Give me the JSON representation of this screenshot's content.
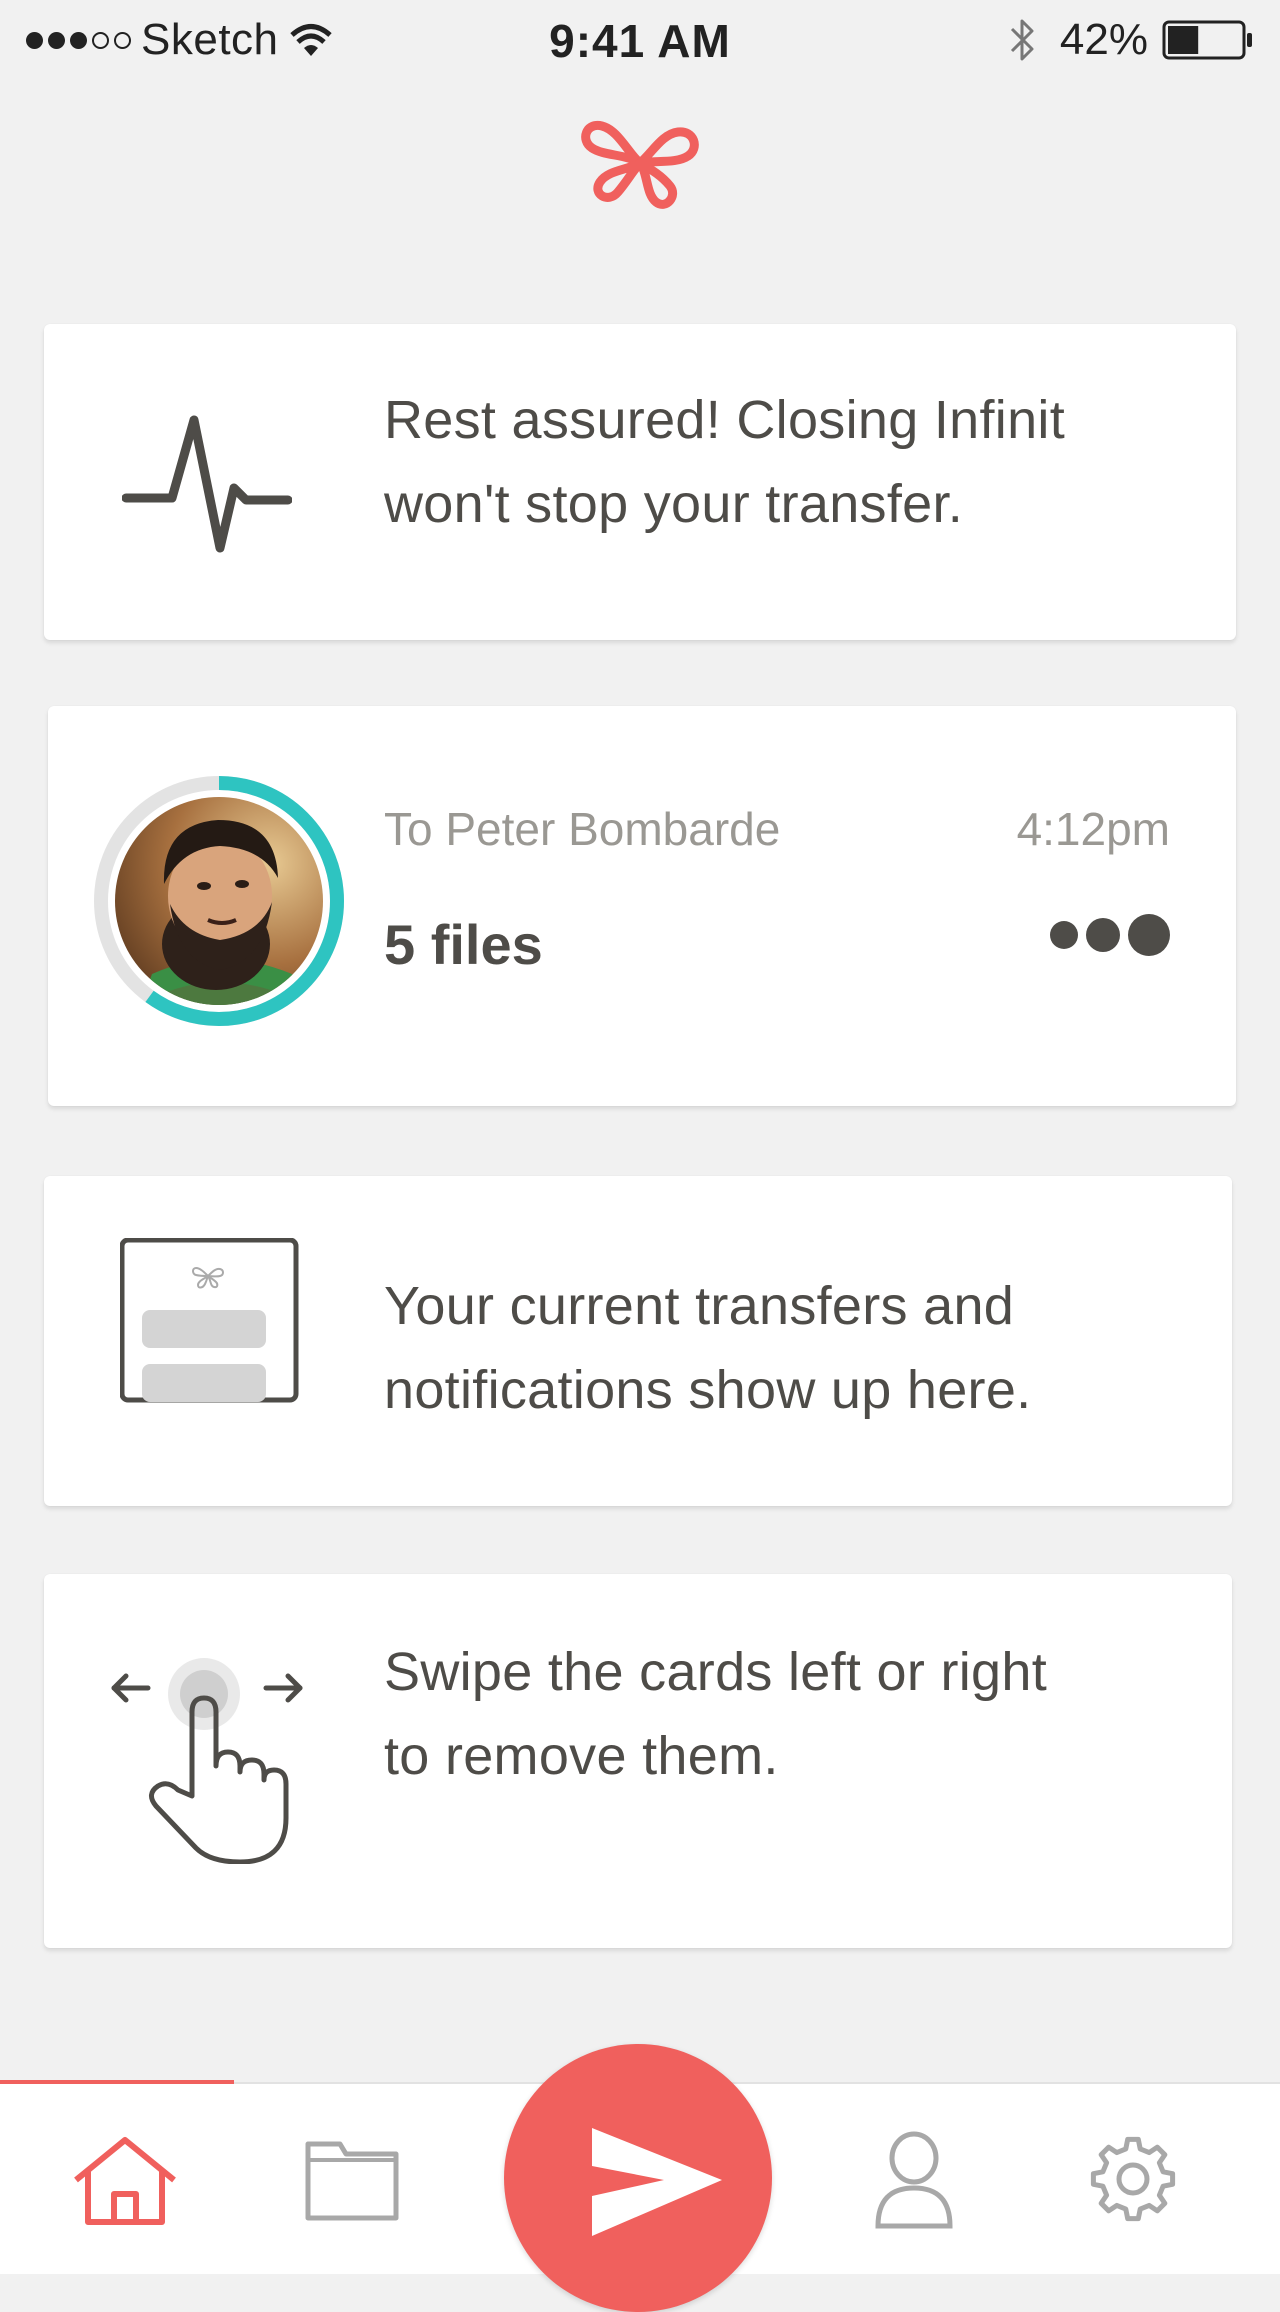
{
  "status_bar": {
    "signal_dots": [
      "full",
      "full",
      "full",
      "empty",
      "empty"
    ],
    "carrier": "Sketch",
    "time": "9:41 AM",
    "battery_percent": "42%",
    "battery_level": 0.42
  },
  "colors": {
    "accent": "#f0605d",
    "progress_teal": "#2ec4c1",
    "text_dark": "#4e4c48",
    "text_muted": "#9a9893",
    "background": "#f1f1f1"
  },
  "cards": {
    "background_info": {
      "icon": "pulse-icon",
      "text_line1": "Rest assured! Closing Infinit",
      "text_line2": "won't stop your transfer."
    },
    "transfer": {
      "recipient": "To Peter Bombarde",
      "time": "4:12pm",
      "files": "5 files",
      "progress": 0.6,
      "avatar": "avatar-peter-bombarde"
    },
    "notifications_info": {
      "icon": "phone-cards-icon",
      "text_line1": "Your current transfers and",
      "text_line2": "notifications show up here."
    },
    "swipe_info": {
      "icon": "swipe-hand-icon",
      "text_line1": "Swipe the cards left or right",
      "text_line2": "to remove them."
    }
  },
  "tab_bar": {
    "tabs": [
      {
        "name": "home",
        "icon": "home-icon",
        "active": true
      },
      {
        "name": "files",
        "icon": "folder-icon",
        "active": false
      },
      {
        "name": "send",
        "icon": "send-icon",
        "active": false
      },
      {
        "name": "contacts",
        "icon": "person-icon",
        "active": false
      },
      {
        "name": "settings",
        "icon": "gear-icon",
        "active": false
      }
    ]
  }
}
